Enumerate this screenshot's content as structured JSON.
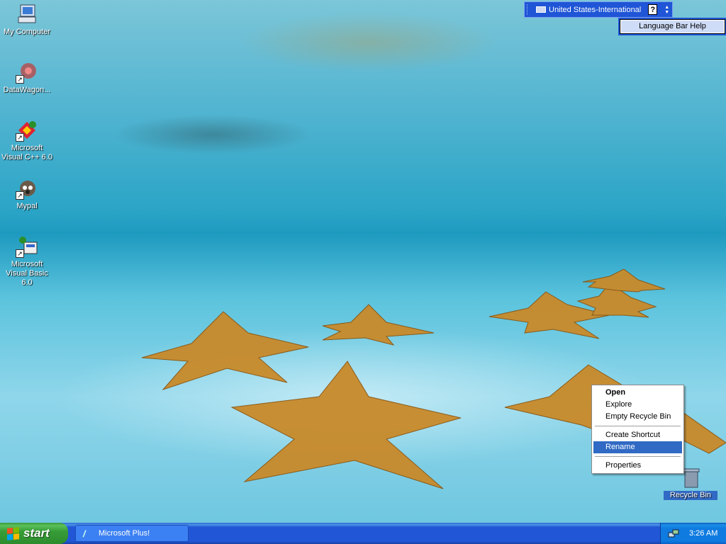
{
  "desktop": {
    "icons": [
      {
        "label": "My Computer",
        "icon": "my-computer-icon"
      },
      {
        "label": "DataWagon...",
        "icon": "datawagon-icon"
      },
      {
        "label": "Microsoft Visual C++ 6.0",
        "icon": "visual-cpp-icon"
      },
      {
        "label": "Mypal",
        "icon": "mypal-icon"
      },
      {
        "label": "Microsoft Visual Basic 6.0",
        "icon": "visual-basic-icon"
      },
      {
        "label": "Recycle Bin",
        "icon": "recycle-bin-icon"
      }
    ]
  },
  "language_bar": {
    "language": "United States-International",
    "help_symbol": "?",
    "tooltip": "Language Bar Help"
  },
  "context_menu": {
    "items": [
      {
        "label": "Open",
        "default": true
      },
      {
        "label": "Explore"
      },
      {
        "label": "Empty Recycle Bin"
      },
      {
        "label": "Create Shortcut"
      },
      {
        "label": "Rename",
        "highlighted": true
      },
      {
        "label": "Properties"
      }
    ]
  },
  "taskbar": {
    "start_label": "start",
    "tasks": [
      {
        "label": "Microsoft Plus!",
        "icon": "microsoft-plus-icon"
      }
    ],
    "clock": "3:26 AM",
    "tray_icon": "network-icon"
  },
  "colors": {
    "taskbar_blue": "#2157d7",
    "start_green": "#379d37",
    "menu_highlight": "#316ac5"
  }
}
